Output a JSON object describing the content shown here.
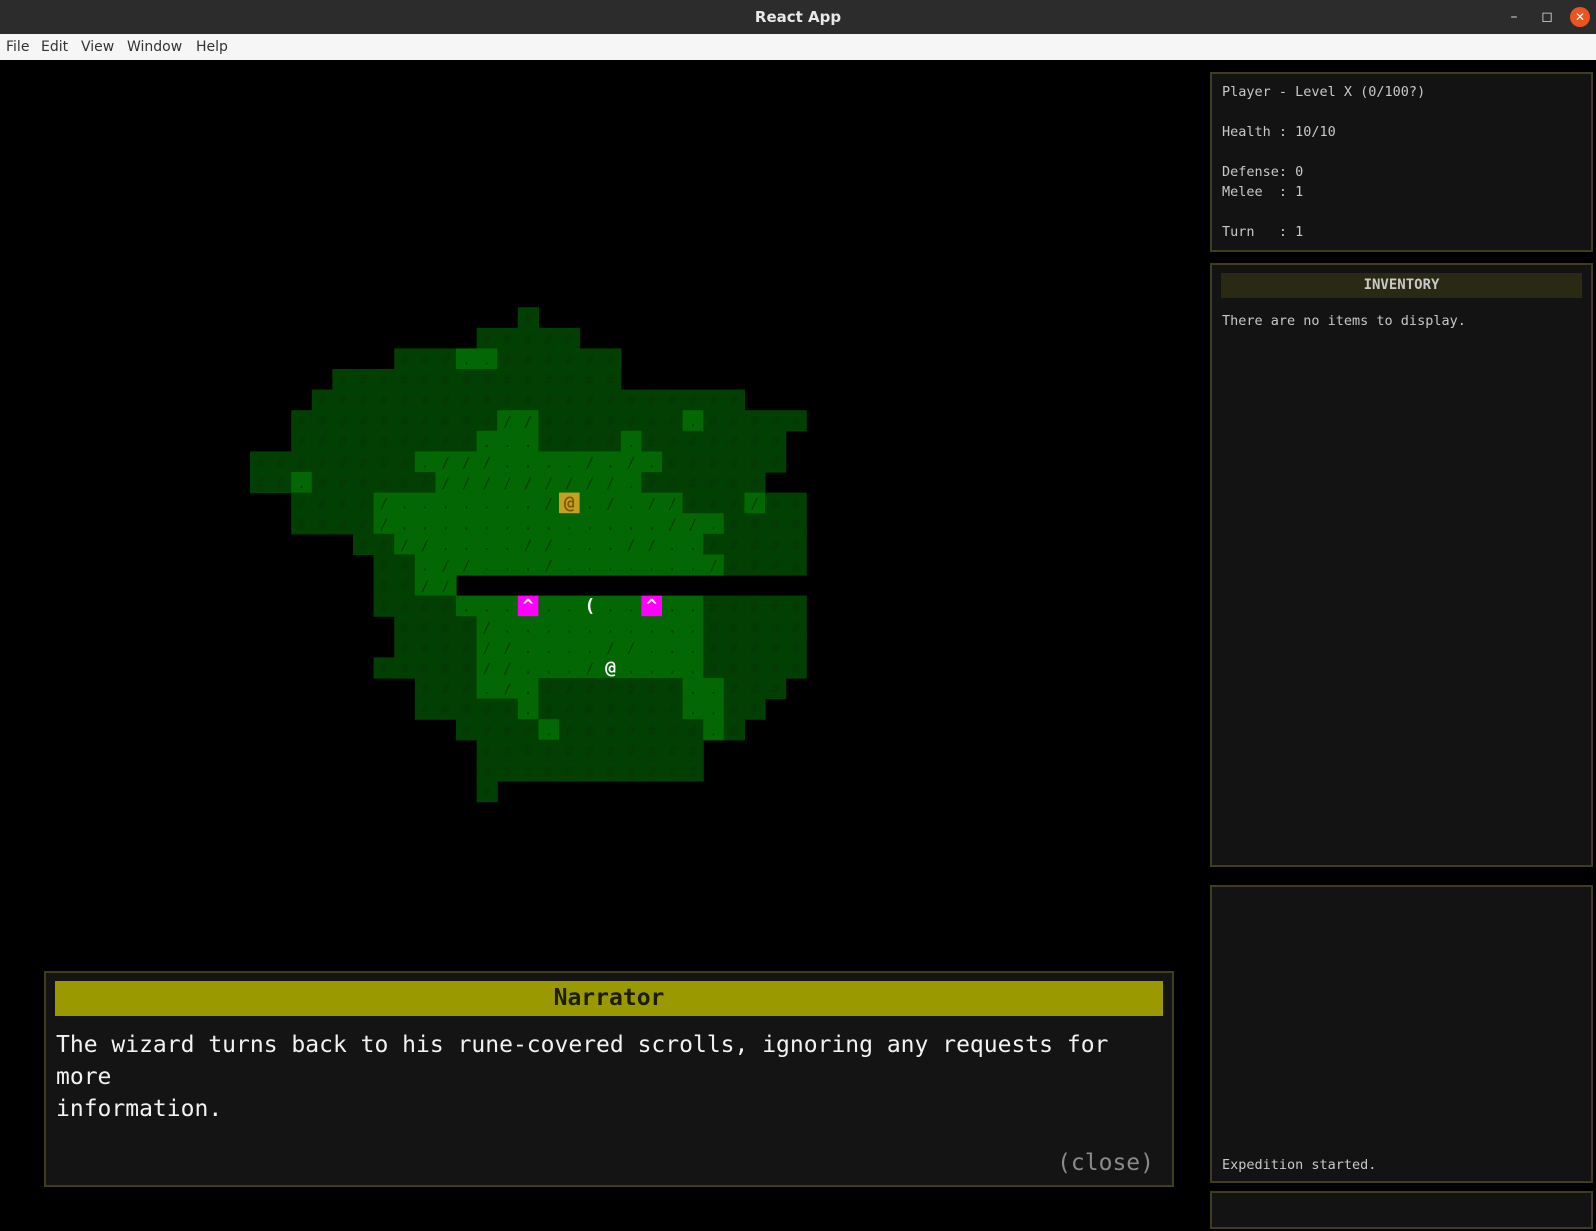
{
  "window": {
    "title": "React App",
    "minimize": "–",
    "maximize": "◻",
    "close": "✕"
  },
  "menu": [
    "File",
    "Edit",
    "View",
    "Window",
    "Help"
  ],
  "stats": {
    "player": "Player - Level X (0/100?)",
    "health": "Health : 10/10",
    "defense": "Defense: 0",
    "melee": "Melee  : 1",
    "turn": "Turn   : 1"
  },
  "inventory": {
    "title": "INVENTORY",
    "empty": "There are no items to display."
  },
  "log": {
    "latest": "Expedition started."
  },
  "dialog": {
    "title": "Narrator",
    "text": "The wizard turns back to his rune-covered scrolls, ignoring any requests for more\ninformation.",
    "close": "(close)"
  },
  "map": {
    "grid": [
      "...........................",
      "...........................",
      "...........................",
      "...........................",
      "...........................",
      "...........................",
      "...........................",
      "...........................",
      "...........................",
      "...........................",
      "...........................",
      "...........................",
      ".............#.............",
      "...........#####...........",
      ".......###..######.........",
      "....##############.........",
      "...#####################...",
      "..##########//#######.#####",
      "..#########...####.#######.",
      "########.///...././.######.",
      "##.######/////////.######..",
      "..####/......./@././/###/##",
      "..####/.............//.####",
      ".....##//....//...//..#####",
      "......##.//.../......./####",
      "......##//....................",
      "......####...^..(..^..#####",
      ".......####/..........#####",
      ".......####//....//...#####",
      "......#####//.../@....#####",
      "........###./.#######..###.",
      "........#####.#######..##..",
      "..........####.#######.#...",
      "...........###########.....",
      "...........###########.....",
      "...........#.............."
    ],
    "legend": {
      "wall": "#",
      "grass": "/",
      "floor": ".",
      "wizard": "@",
      "player": "@",
      "trap": "^",
      "item": "("
    },
    "colors": {
      "wall_bg": "#023f02",
      "wall_fg": "#073607",
      "floor_bg": "#036703",
      "floor_fg": "#0a3a0a",
      "wizard_bg": "#c8a020",
      "trap_bg": "#ff00ff",
      "text_fg": "#ffffff"
    }
  }
}
